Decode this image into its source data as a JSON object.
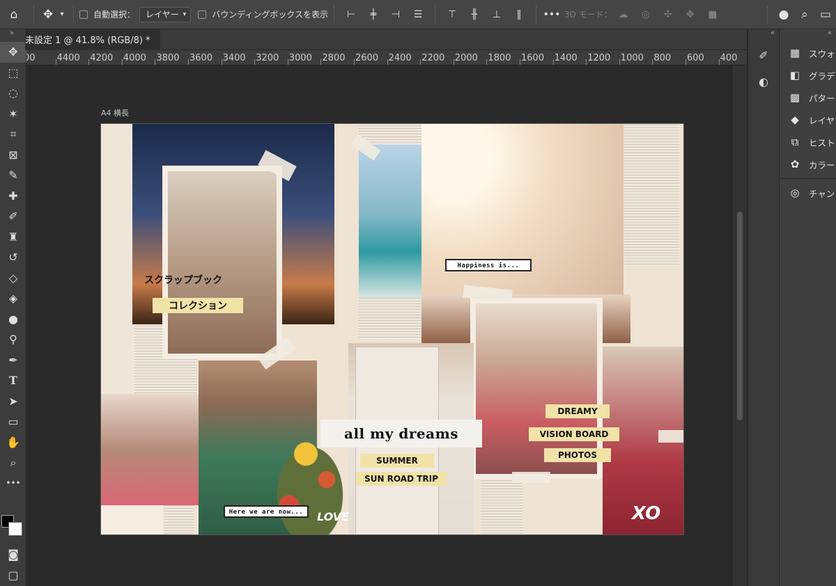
{
  "options_bar": {
    "auto_select_label": "自動選択：",
    "auto_select_value": "レイヤー",
    "bounding_box_label": "バウンディングボックスを表示",
    "three_d_mode_label": "3D モード："
  },
  "document": {
    "tab_title": "未設定 1 @ 41.8% (RGB/8) *",
    "artboard_label": "A4 横長"
  },
  "ruler": {
    "labels": [
      "00",
      "4400",
      "4200",
      "4000",
      "3800",
      "3600",
      "3400",
      "3200",
      "3000",
      "2800",
      "2600",
      "2400",
      "2200",
      "2000",
      "1800",
      "1600",
      "1400",
      "1200",
      "1000",
      "800",
      "600",
      "400"
    ]
  },
  "panels": {
    "items": [
      {
        "label": "スウォ",
        "icon": "grid-icon"
      },
      {
        "label": "グラデ",
        "icon": "gradient-icon"
      },
      {
        "label": "パター",
        "icon": "pattern-icon"
      },
      {
        "label": "レイヤ",
        "icon": "layers-icon"
      },
      {
        "label": "ヒスト",
        "icon": "history-icon"
      },
      {
        "label": "カラー",
        "icon": "palette-icon"
      },
      {
        "label": "チャン",
        "icon": "channels-icon"
      }
    ]
  },
  "collage": {
    "jp_line1": "スクラップブック",
    "jp_line2": "コレクション",
    "happiness": "Happiness is...",
    "all_my_dreams": "all my dreams",
    "summer": "SUMMER",
    "sun_road_trip": "SUN ROAD TRIP",
    "dreamy": "DREAMY",
    "vision_board": "VISION BOARD",
    "photos": "PHOTOS",
    "here_we_are": "Here we are now...",
    "love": "LOVE",
    "xo": "XO"
  },
  "colors": {
    "app_bg": "#2b2b2b",
    "panel_bg": "#3f3f3f",
    "highlight_yellow": "#f1e2a8"
  }
}
